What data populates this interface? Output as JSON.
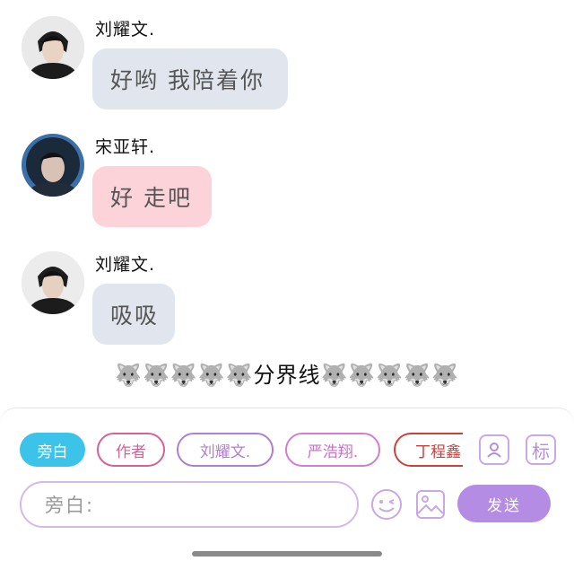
{
  "messages": [
    {
      "sender": "刘耀文.",
      "text": "好哟 我陪着你",
      "bubble_color": "#e1e6ee"
    },
    {
      "sender": "宋亚轩.",
      "text": "好 走吧",
      "bubble_color": "#fcd3d9"
    },
    {
      "sender": "刘耀文.",
      "text": "吸吸",
      "bubble_color": "#e1e6ee"
    }
  ],
  "divider": {
    "text": "🐺🐺🐺🐺🐺分界线🐺🐺🐺🐺🐺"
  },
  "roles": [
    {
      "label": "旁白",
      "color": "#3cc3ea",
      "active": true
    },
    {
      "label": "作者",
      "color": "#d0649a",
      "active": false
    },
    {
      "label": "刘耀文.",
      "color": "#b07fd0",
      "active": false
    },
    {
      "label": "严浩翔.",
      "color": "#d07fd0",
      "active": false
    },
    {
      "label": "丁程鑫",
      "color": "#c7423d",
      "active": false
    }
  ],
  "toolbar": {
    "label_icon_text": "标"
  },
  "composer": {
    "placeholder": "旁白:",
    "send_label": "发送"
  },
  "icons": {
    "contact": "contact-card-icon",
    "label": "label-icon",
    "emoji": "emoji-icon",
    "image": "image-icon"
  }
}
